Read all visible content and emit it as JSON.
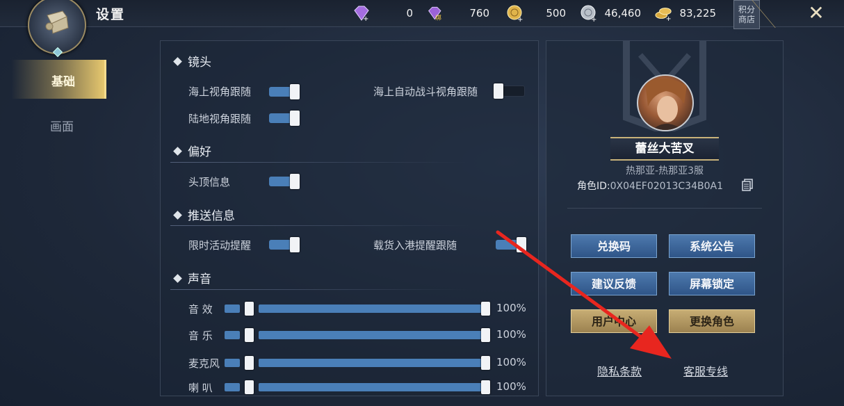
{
  "header": {
    "title": "设置",
    "currencies": [
      {
        "icon": "purple-gem-icon",
        "value": "0",
        "sub": ""
      },
      {
        "icon": "bound-gem-icon",
        "value": "760",
        "sub": "绑"
      },
      {
        "icon": "gold-coin-icon",
        "value": "500",
        "sub": ""
      },
      {
        "icon": "silver-coin-icon",
        "value": "46,460",
        "sub": ""
      },
      {
        "icon": "gold-pile-icon",
        "value": "83,225",
        "sub": ""
      }
    ],
    "shop_label": "积分商店",
    "close_label": "✕"
  },
  "tabs": [
    {
      "label": "基础",
      "active": true
    },
    {
      "label": "画面",
      "active": false
    }
  ],
  "settings": {
    "camera": {
      "title": "镜头",
      "sea_follow": {
        "label": "海上视角跟随",
        "on": true
      },
      "auto_battle_follow": {
        "label": "海上自动战斗视角跟随",
        "on": false
      },
      "land_follow": {
        "label": "陆地视角跟随",
        "on": true
      }
    },
    "preference": {
      "title": "偏好",
      "head_info": {
        "label": "头顶信息",
        "on": true
      }
    },
    "push": {
      "title": "推送信息",
      "limited_event": {
        "label": "限时活动提醒",
        "on": true
      },
      "cargo_port": {
        "label": "载货入港提醒跟随",
        "on": true
      }
    },
    "sound": {
      "title": "声音",
      "sfx": {
        "label": "音 效",
        "value": "100%",
        "level": 1.0
      },
      "music": {
        "label": "音 乐",
        "value": "100%",
        "level": 1.0
      },
      "mic": {
        "label": "麦克风",
        "value": "100%",
        "level": 1.0
      },
      "speaker": {
        "label": "喇 叭",
        "value": "100%",
        "level": 1.0
      }
    }
  },
  "profile": {
    "name": "蕾丝大苦叉",
    "server": "热那亚-热那亚3服",
    "role_id_label": "角色ID:",
    "role_id_value": "0X04EF02013C34B0A1",
    "buttons": {
      "redeem": "兑换码",
      "announce": "系统公告",
      "feedback": "建议反馈",
      "lock": "屏幕锁定",
      "user_center": "用户中心",
      "switch_role": "更换角色"
    },
    "links": {
      "privacy": "隐私条款",
      "support": "客服专线"
    }
  },
  "colors": {
    "toggle_on": "#4a7fb8",
    "gold": "#e6c76e",
    "arrow": "#e8261f"
  }
}
